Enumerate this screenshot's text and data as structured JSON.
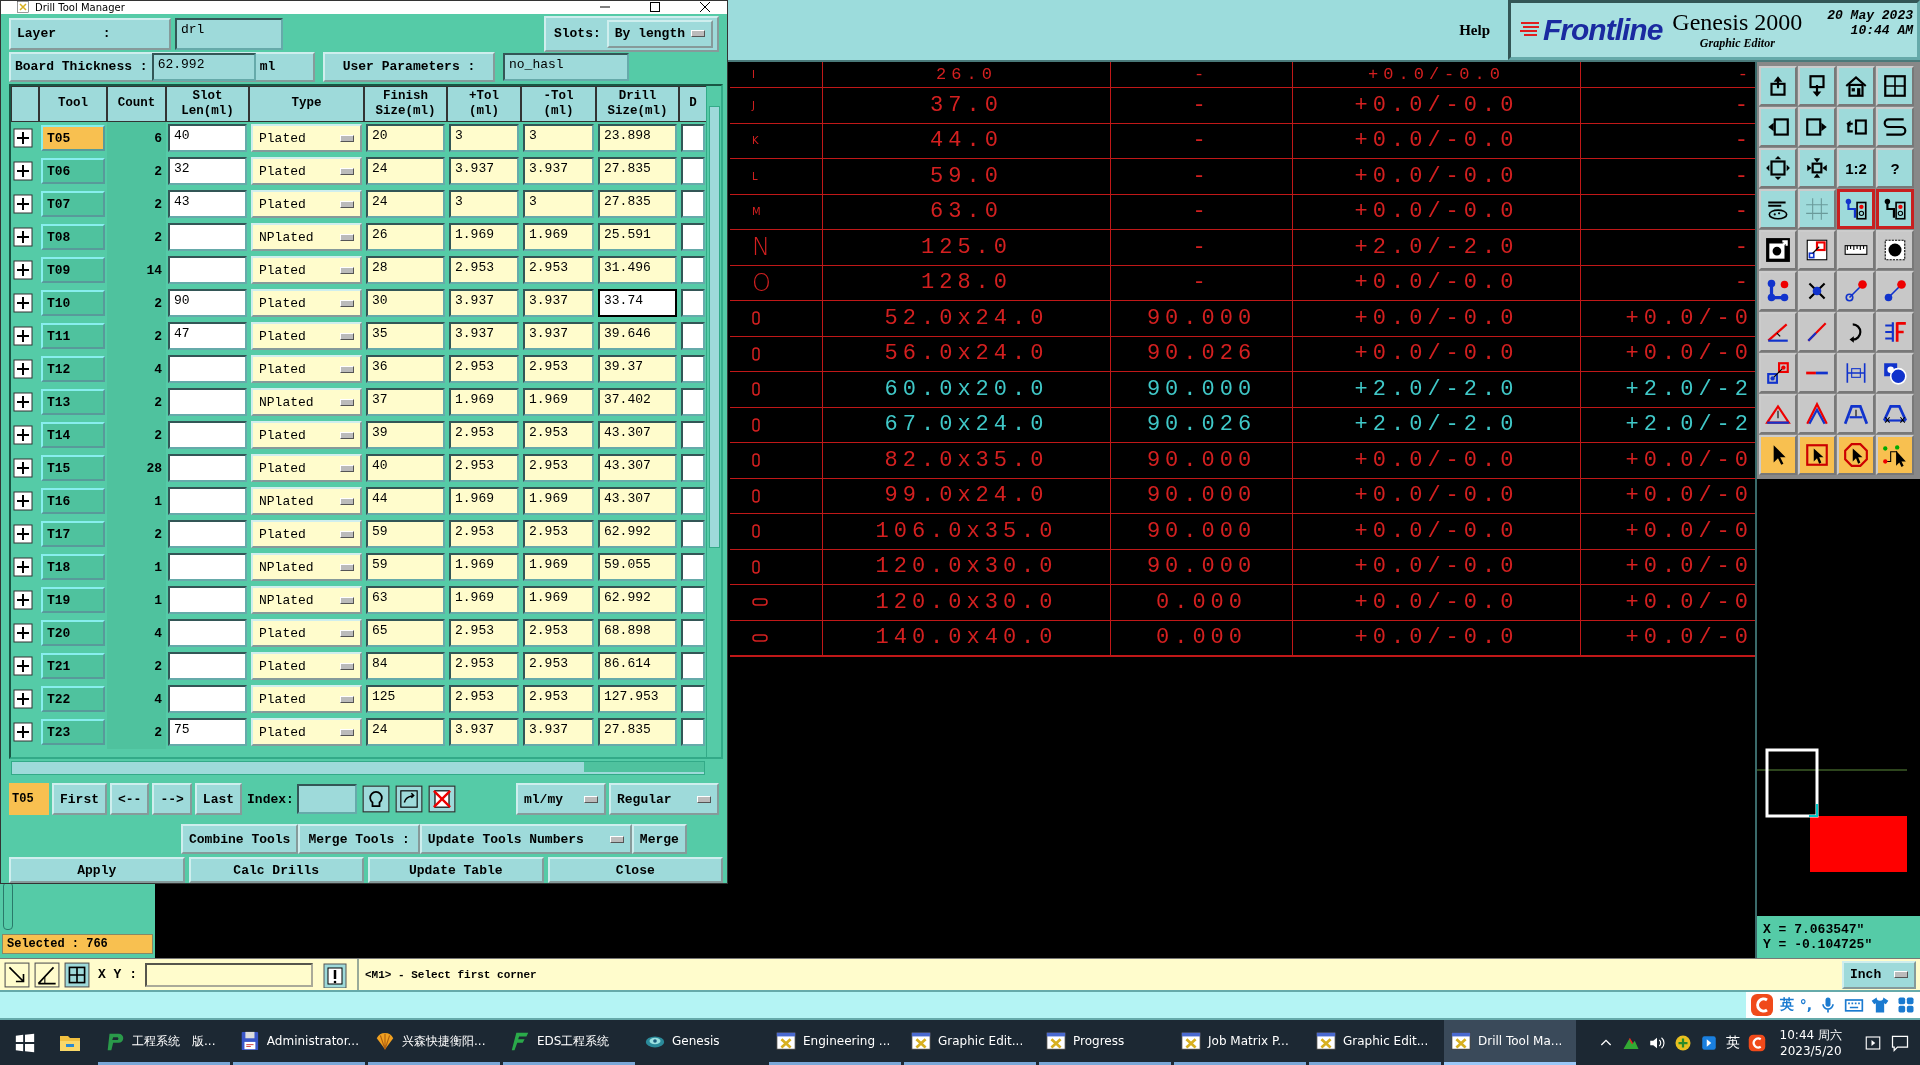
{
  "dialog": {
    "title": "Drill Tool Manager",
    "layer": {
      "label": "Layer      :",
      "value": "drl"
    },
    "slots": {
      "label": "Slots:",
      "value": "By length"
    },
    "board_thickness": {
      "label": "Board Thickness :",
      "value": "62.992",
      "unit": "ml"
    },
    "user_parameters": {
      "label": "User Parameters :",
      "value": "no_hasl"
    },
    "columns": [
      "Tool",
      "Count",
      "Slot\nLen(ml)",
      "Type",
      "Finish\nSize(ml)",
      "+Tol\n(ml)",
      "-Tol\n(ml)",
      "Drill\nSize(ml)",
      "D"
    ],
    "rows": [
      {
        "tool": "T05",
        "count": "6",
        "slot_len": "40",
        "type": "Plated",
        "finish": "20",
        "plus_tol": "3",
        "minus_tol": "3",
        "drill": "23.898",
        "selected": true,
        "drill_focused": false
      },
      {
        "tool": "T06",
        "count": "2",
        "slot_len": "32",
        "type": "Plated",
        "finish": "24",
        "plus_tol": "3.937",
        "minus_tol": "3.937",
        "drill": "27.835",
        "selected": false,
        "drill_focused": false
      },
      {
        "tool": "T07",
        "count": "2",
        "slot_len": "43",
        "type": "Plated",
        "finish": "24",
        "plus_tol": "3",
        "minus_tol": "3",
        "drill": "27.835",
        "selected": false,
        "drill_focused": false
      },
      {
        "tool": "T08",
        "count": "2",
        "type": "NPlated",
        "finish": "26",
        "plus_tol": "1.969",
        "minus_tol": "1.969",
        "drill": "25.591",
        "selected": false,
        "drill_focused": false
      },
      {
        "tool": "T09",
        "count": "14",
        "type": "Plated",
        "finish": "28",
        "plus_tol": "2.953",
        "minus_tol": "2.953",
        "drill": "31.496",
        "selected": false,
        "drill_focused": false
      },
      {
        "tool": "T10",
        "count": "2",
        "slot_len": "90",
        "type": "Plated",
        "finish": "30",
        "plus_tol": "3.937",
        "minus_tol": "3.937",
        "drill": "33.74",
        "selected": false,
        "drill_focused": true
      },
      {
        "tool": "T11",
        "count": "2",
        "slot_len": "47",
        "type": "Plated",
        "finish": "35",
        "plus_tol": "3.937",
        "minus_tol": "3.937",
        "drill": "39.646",
        "selected": false,
        "drill_focused": false
      },
      {
        "tool": "T12",
        "count": "4",
        "type": "Plated",
        "finish": "36",
        "plus_tol": "2.953",
        "minus_tol": "2.953",
        "drill": "39.37",
        "selected": false,
        "drill_focused": false
      },
      {
        "tool": "T13",
        "count": "2",
        "type": "NPlated",
        "finish": "37",
        "plus_tol": "1.969",
        "minus_tol": "1.969",
        "drill": "37.402",
        "selected": false,
        "drill_focused": false
      },
      {
        "tool": "T14",
        "count": "2",
        "type": "Plated",
        "finish": "39",
        "plus_tol": "2.953",
        "minus_tol": "2.953",
        "drill": "43.307",
        "selected": false,
        "drill_focused": false
      },
      {
        "tool": "T15",
        "count": "28",
        "type": "Plated",
        "finish": "40",
        "plus_tol": "2.953",
        "minus_tol": "2.953",
        "drill": "43.307",
        "selected": false,
        "drill_focused": false
      },
      {
        "tool": "T16",
        "count": "1",
        "type": "NPlated",
        "finish": "44",
        "plus_tol": "1.969",
        "minus_tol": "1.969",
        "drill": "43.307",
        "selected": false,
        "drill_focused": false
      },
      {
        "tool": "T17",
        "count": "2",
        "type": "Plated",
        "finish": "59",
        "plus_tol": "2.953",
        "minus_tol": "2.953",
        "drill": "62.992",
        "selected": false,
        "drill_focused": false
      },
      {
        "tool": "T18",
        "count": "1",
        "type": "NPlated",
        "finish": "59",
        "plus_tol": "1.969",
        "minus_tol": "1.969",
        "drill": "59.055",
        "selected": false,
        "drill_focused": false
      },
      {
        "tool": "T19",
        "count": "1",
        "type": "NPlated",
        "finish": "63",
        "plus_tol": "1.969",
        "minus_tol": "1.969",
        "drill": "62.992",
        "selected": false,
        "drill_focused": false
      },
      {
        "tool": "T20",
        "count": "4",
        "type": "Plated",
        "finish": "65",
        "plus_tol": "2.953",
        "minus_tol": "2.953",
        "drill": "68.898",
        "selected": false,
        "drill_focused": false
      },
      {
        "tool": "T21",
        "count": "2",
        "type": "Plated",
        "finish": "84",
        "plus_tol": "2.953",
        "minus_tol": "2.953",
        "drill": "86.614",
        "selected": false,
        "drill_focused": false
      },
      {
        "tool": "T22",
        "count": "4",
        "type": "Plated",
        "finish": "125",
        "plus_tol": "2.953",
        "minus_tol": "2.953",
        "drill": "127.953",
        "selected": false,
        "drill_focused": false
      },
      {
        "tool": "T23",
        "count": "2",
        "slot_len": "75",
        "type": "Plated",
        "finish": "24",
        "plus_tol": "3.937",
        "minus_tol": "3.937",
        "drill": "27.835",
        "selected": false,
        "drill_focused": false
      }
    ],
    "nav": {
      "current": "T05",
      "buttons": [
        "First",
        "<--",
        "-->",
        "Last"
      ],
      "index_label": "Index:",
      "units": "ml/my",
      "mode": "Regular"
    },
    "merge": {
      "combine": "Combine Tools",
      "label": "Merge Tools :",
      "option": "Update Tools Numbers",
      "button": "Merge"
    },
    "actions": [
      "Apply",
      "Calc Drills",
      "Update Table",
      "Close"
    ]
  },
  "header": {
    "help": "Help",
    "brand": "Frontline",
    "product": "Genesis 2000",
    "subtitle": "Graphic Editor",
    "date": "20 May 2023",
    "time": "10:44 AM"
  },
  "left_panel": {
    "selected": "Selected : 766"
  },
  "canvas_table": {
    "rows": [
      {
        "kind": "letter_small",
        "symbol": "I",
        "column_2": "26.0",
        "column_3": "-",
        "column_4": "+0.0/-0.0",
        "column_5": "-",
        "selected": false
      },
      {
        "kind": "letter_small",
        "symbol": "J",
        "column_2": "37.0",
        "column_3": "-",
        "column_4": "+0.0/-0.0",
        "column_5": "-",
        "selected": false
      },
      {
        "kind": "letter_small",
        "symbol": "K",
        "column_2": "44.0",
        "column_3": "-",
        "column_4": "+0.0/-0.0",
        "column_5": "-",
        "selected": false
      },
      {
        "kind": "letter_small",
        "symbol": "L",
        "column_2": "59.0",
        "column_3": "-",
        "column_4": "+0.0/-0.0",
        "column_5": "-",
        "selected": false
      },
      {
        "kind": "letter_small",
        "symbol": "M",
        "column_2": "63.0",
        "column_3": "-",
        "column_4": "+0.0/-0.0",
        "column_5": "-",
        "selected": false
      },
      {
        "kind": "letter_large",
        "symbol": "N",
        "column_2": "125.0",
        "column_3": "-",
        "column_4": "+2.0/-2.0",
        "column_5": "-",
        "selected": false
      },
      {
        "kind": "letter_large",
        "symbol": "O",
        "column_2": "128.0",
        "column_3": "-",
        "column_4": "+0.0/-0.0",
        "column_5": "-",
        "selected": false
      },
      {
        "kind": "slot_v",
        "column_2": "52.0x24.0",
        "column_3": "90.000",
        "column_4": "+0.0/-0.0",
        "column_5": "+0.0/-0",
        "selected": false
      },
      {
        "kind": "slot_v",
        "column_2": "56.0x24.0",
        "column_3": "90.026",
        "column_4": "+0.0/-0.0",
        "column_5": "+0.0/-0",
        "selected": false
      },
      {
        "kind": "slot_v",
        "column_2": "60.0x20.0",
        "column_3": "90.000",
        "column_4": "+2.0/-2.0",
        "column_5": "+2.0/-2",
        "selected": true
      },
      {
        "kind": "slot_v",
        "column_2": "67.0x24.0",
        "column_3": "90.026",
        "column_4": "+2.0/-2.0",
        "column_5": "+2.0/-2",
        "selected": true
      },
      {
        "kind": "slot_v",
        "column_2": "82.0x35.0",
        "column_3": "90.000",
        "column_4": "+0.0/-0.0",
        "column_5": "+0.0/-0",
        "selected": false
      },
      {
        "kind": "slot_v",
        "column_2": "99.0x24.0",
        "column_3": "90.000",
        "column_4": "+0.0/-0.0",
        "column_5": "+0.0/-0",
        "selected": false
      },
      {
        "kind": "slot_v",
        "column_2": "106.0x35.0",
        "column_3": "90.000",
        "column_4": "+0.0/-0.0",
        "column_5": "+0.0/-0",
        "selected": false
      },
      {
        "kind": "slot_v",
        "column_2": "120.0x30.0",
        "column_3": "90.000",
        "column_4": "+0.0/-0.0",
        "column_5": "+0.0/-0",
        "selected": false
      },
      {
        "kind": "slot_h",
        "column_2": "120.0x30.0",
        "column_3": "0.000",
        "column_4": "+0.0/-0.0",
        "column_5": "+0.0/-0",
        "selected": false
      },
      {
        "kind": "slot_h",
        "column_2": "140.0x40.0",
        "column_3": "0.000",
        "column_4": "+0.0/-0.0",
        "column_5": "+0.0/-0",
        "selected": false
      }
    ]
  },
  "tool_buttons": [
    {
      "kind": "view",
      "active": false
    },
    {
      "kind": "view",
      "active": false
    },
    {
      "kind": "view",
      "active": false
    },
    {
      "kind": "view",
      "active": false
    },
    {
      "kind": "view",
      "active": false
    },
    {
      "kind": "view",
      "active": false
    },
    {
      "kind": "view",
      "active": false
    },
    {
      "kind": "view",
      "active": false
    },
    {
      "kind": "view",
      "active": false
    },
    {
      "kind": "view",
      "active": false
    },
    {
      "kind": "view",
      "active": false,
      "label": "1:2"
    },
    {
      "kind": "view",
      "active": false,
      "label": "?"
    },
    {
      "kind": "view",
      "active": false
    },
    {
      "kind": "view",
      "active": false
    },
    {
      "kind": "view",
      "active": true
    },
    {
      "kind": "view",
      "active": true
    },
    {
      "kind": "edit",
      "active": false
    },
    {
      "kind": "edit",
      "active": false
    },
    {
      "kind": "edit",
      "active": false
    },
    {
      "kind": "edit",
      "active": false
    },
    {
      "kind": "edit",
      "active": false
    },
    {
      "kind": "edit",
      "active": false
    },
    {
      "kind": "edit",
      "active": false
    },
    {
      "kind": "edit",
      "active": false
    },
    {
      "kind": "edit",
      "active": false
    },
    {
      "kind": "edit",
      "active": false
    },
    {
      "kind": "edit",
      "active": false
    },
    {
      "kind": "edit",
      "active": false
    },
    {
      "kind": "edit",
      "active": false
    },
    {
      "kind": "edit",
      "active": false
    },
    {
      "kind": "edit",
      "active": false
    },
    {
      "kind": "edit",
      "active": false
    },
    {
      "kind": "edit",
      "active": false
    },
    {
      "kind": "edit",
      "active": false
    },
    {
      "kind": "edit",
      "active": false
    },
    {
      "kind": "edit",
      "active": false
    },
    {
      "kind": "select",
      "active": false
    },
    {
      "kind": "select",
      "active": false
    },
    {
      "kind": "select",
      "active": false
    },
    {
      "kind": "select",
      "active": false
    }
  ],
  "coordinates": {
    "x": "X = 7.063547\"",
    "y": "Y = -0.104725\""
  },
  "status": {
    "xy_label": "X Y :",
    "message": "<M1> - Select first corner",
    "units": "Inch"
  },
  "ime": {
    "mode": "英",
    "punct": "°,"
  },
  "taskbar": {
    "apps": [
      {
        "kind": "p_logo",
        "label": "工程系统　版...",
        "active": false
      },
      {
        "kind": "floppy",
        "label": "Administrator...",
        "active": false
      },
      {
        "kind": "shell",
        "label": "兴森快捷衡阳...",
        "active": false
      },
      {
        "kind": "f_logo",
        "label": "EDS工程系统",
        "active": false
      },
      {
        "kind": "swirl",
        "label": "Genesis",
        "active": false
      },
      {
        "kind": "window",
        "label": "Engineering ...",
        "active": false
      },
      {
        "kind": "window",
        "label": "Graphic Edit...",
        "active": false
      },
      {
        "kind": "window",
        "label": "Progress",
        "active": false
      },
      {
        "kind": "window",
        "label": "Job Matrix P...",
        "active": false
      },
      {
        "kind": "window",
        "label": "Graphic Edit...",
        "active": false
      },
      {
        "kind": "window",
        "label": "Drill Tool Ma...",
        "active": true
      }
    ],
    "lang": "英",
    "time": "10:44 周六",
    "date": "2023/5/20"
  }
}
